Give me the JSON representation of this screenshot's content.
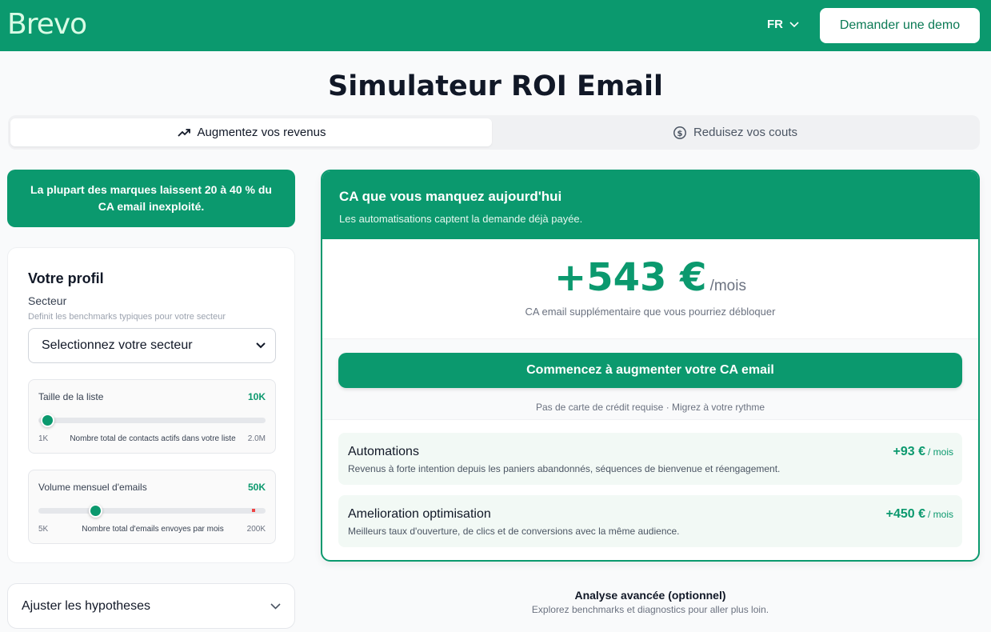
{
  "header": {
    "logo": "Brevo",
    "language": "FR",
    "demo_button": "Demander une demo"
  },
  "page": {
    "title": "Simulateur ROI Email"
  },
  "tabs": [
    {
      "label": "Augmentez vos revenus",
      "active": true,
      "icon": "trending-up-icon"
    },
    {
      "label": "Reduisez vos couts",
      "active": false,
      "icon": "dollar-circle-icon"
    }
  ],
  "banner": {
    "text": "La plupart des marques laissent 20 à 40 % du CA email inexploité."
  },
  "profile": {
    "title": "Votre profil",
    "sector_label": "Secteur",
    "sector_help": "Definit les benchmarks typiques pour votre secteur",
    "sector_select": "Selectionnez votre secteur",
    "list_size": {
      "label": "Taille de la liste",
      "value": "10K",
      "min": "1K",
      "max": "2.0M",
      "help": "Nombre total de contacts actifs dans votre liste",
      "position_fraction": 0.04
    },
    "monthly_volume": {
      "label": "Volume mensuel d'emails",
      "value": "50K",
      "min": "5K",
      "max": "200K",
      "help": "Nombre total d'emails envoyes par mois",
      "position_fraction": 0.25,
      "marker_fraction": 0.94
    }
  },
  "adjust": {
    "label": "Ajuster les hypotheses"
  },
  "results": {
    "title": "CA que vous manquez aujourd'hui",
    "subtitle": "Les automatisations captent la demande déjà payée.",
    "amount": "+543 €",
    "amount_unit": "/mois",
    "amount_desc": "CA email supplémentaire que vous pourriez débloquer",
    "cta": "Commencez à augmenter votre CA email",
    "cta_note": "Pas de carte de crédit requise · Migrez à votre rythme",
    "rows": [
      {
        "title": "Automations",
        "desc": "Revenus à forte intention depuis les paniers abandonnés, séquences de bienvenue et réengagement.",
        "value": "+93 €",
        "unit": "/ mois"
      },
      {
        "title": "Amelioration optimisation",
        "desc": "Meilleurs taux d'ouverture, de clics et de conversions avec la même audience.",
        "value": "+450 €",
        "unit": "/ mois"
      }
    ]
  },
  "advanced": {
    "title": "Analyse avancée (optionnel)",
    "subtitle": "Explorez benchmarks et diagnostics pour aller plus loin."
  },
  "colors": {
    "brand": "#0b996e",
    "logo": "#d8fbe5",
    "accent_bg": "#f2f9f5",
    "marker": "#ef4444"
  }
}
